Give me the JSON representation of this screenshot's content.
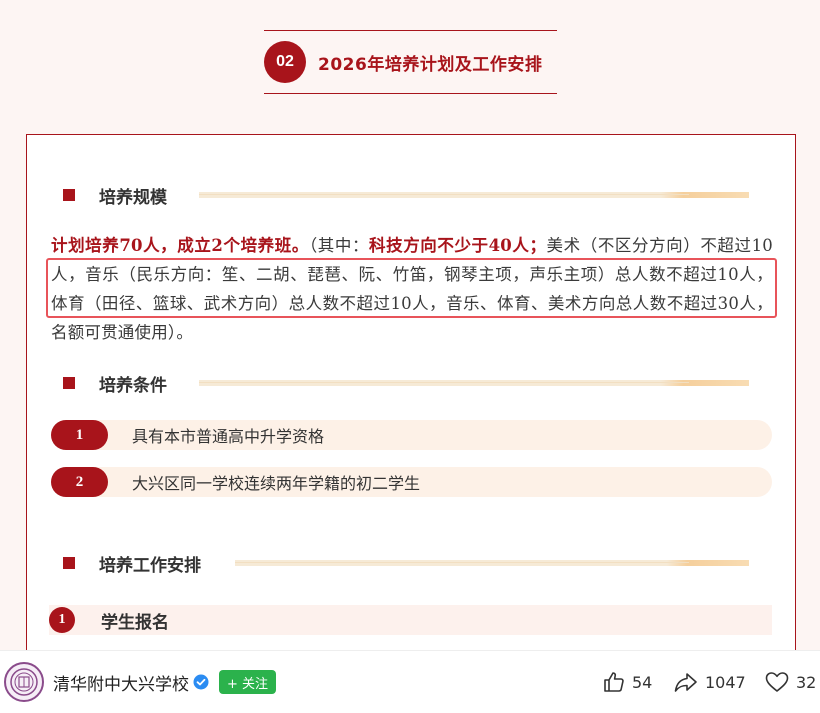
{
  "section": {
    "number": "02",
    "title": "2026年培养计划及工作安排"
  },
  "scale": {
    "heading": "培养规模",
    "lead_bold": "计划培养70人，成立2个培养班。",
    "paren_open": "（其中：",
    "tech_bold": "科技方向不少于40人；",
    "rest": "美术（不区分方向）不超过10人，音乐（民乐方向：笙、二胡、琵琶、阮、竹笛，钢琴主项，声乐主项）总人数不超过10人，体育（田径、篮球、武术方向）总人数不超过10人，音乐、体育、美术方向总人数不超过30人，名额可贯通使用）。"
  },
  "conditions": {
    "heading": "培养条件",
    "items": [
      {
        "num": "1",
        "text": "具有本市普通高中升学资格"
      },
      {
        "num": "2",
        "text": "大兴区同一学校连续两年学籍的初二学生"
      }
    ]
  },
  "schedule": {
    "heading": "培养工作安排",
    "steps": [
      {
        "num": "1",
        "text": "学生报名"
      }
    ]
  },
  "footer": {
    "account_name": "清华附中大兴学校",
    "follow_label": "+ 关注",
    "likes": "54",
    "shares": "1047",
    "favorites": "32"
  },
  "colors": {
    "brand_red": "#a8141b",
    "highlight_border": "#e8545a",
    "follow_green": "#2bb24c"
  }
}
